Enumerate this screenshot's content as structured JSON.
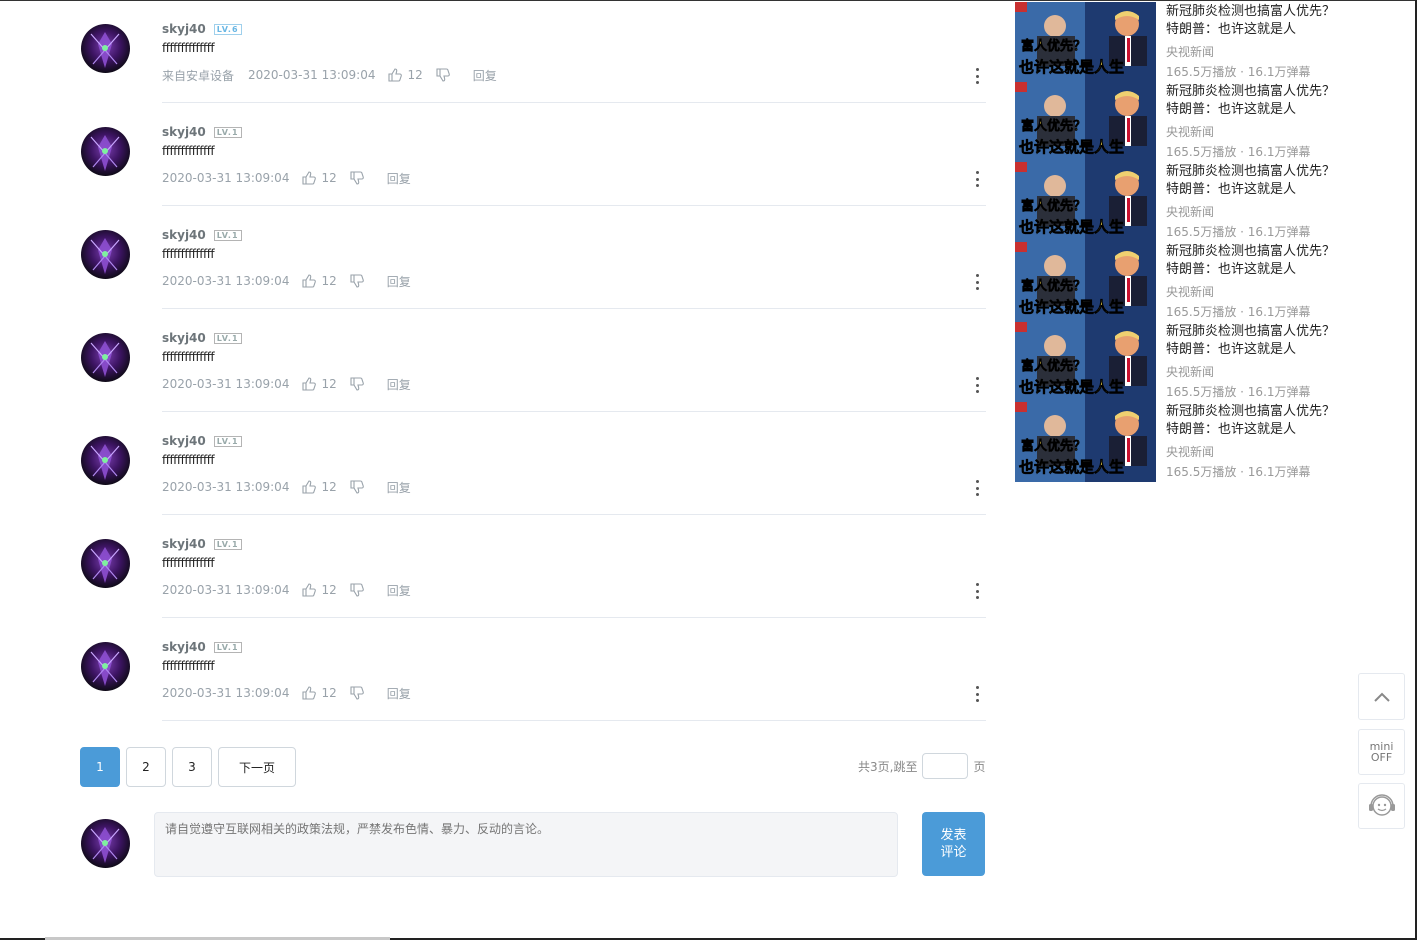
{
  "comments": [
    {
      "user": "skyj40",
      "level": "LV.6",
      "level_color": "blue",
      "text": "ffffffffffffff",
      "device": "来自安卓设备",
      "time": "2020-03-31 13:09:04",
      "likes": "12",
      "reply": "回复"
    },
    {
      "user": "skyj40",
      "level": "LV.1",
      "level_color": "gray",
      "text": "ffffffffffffff",
      "device": "",
      "time": "2020-03-31 13:09:04",
      "likes": "12",
      "reply": "回复"
    },
    {
      "user": "skyj40",
      "level": "LV.1",
      "level_color": "gray",
      "text": "ffffffffffffff",
      "device": "",
      "time": "2020-03-31 13:09:04",
      "likes": "12",
      "reply": "回复"
    },
    {
      "user": "skyj40",
      "level": "LV.1",
      "level_color": "gray",
      "text": "ffffffffffffff",
      "device": "",
      "time": "2020-03-31 13:09:04",
      "likes": "12",
      "reply": "回复"
    },
    {
      "user": "skyj40",
      "level": "LV.1",
      "level_color": "gray",
      "text": "ffffffffffffff",
      "device": "",
      "time": "2020-03-31 13:09:04",
      "likes": "12",
      "reply": "回复"
    },
    {
      "user": "skyj40",
      "level": "LV.1",
      "level_color": "gray",
      "text": "ffffffffffffff",
      "device": "",
      "time": "2020-03-31 13:09:04",
      "likes": "12",
      "reply": "回复"
    },
    {
      "user": "skyj40",
      "level": "LV.1",
      "level_color": "gray",
      "text": "ffffffffffffff",
      "device": "",
      "time": "2020-03-31 13:09:04",
      "likes": "12",
      "reply": "回复"
    }
  ],
  "pagination": {
    "pages": [
      "1",
      "2",
      "3"
    ],
    "current": "1",
    "next_label": "下一页",
    "jump_prefix": "共3页,跳至",
    "jump_suffix": "页"
  },
  "compose": {
    "placeholder": "请自觉遵守互联网相关的政策法规，严禁发布色情、暴力、反动的言论。",
    "submit_line1": "发表",
    "submit_line2": "评论"
  },
  "recommendations": [
    {
      "title": "新冠肺炎检测也搞富人优先？特朗普：也许这就是人",
      "uploader": "央视新闻",
      "stats": "165.5万播放 · 16.1万弹幕",
      "caption1": "富人优先？",
      "caption2": "也许这就是人生"
    },
    {
      "title": "新冠肺炎检测也搞富人优先？特朗普：也许这就是人",
      "uploader": "央视新闻",
      "stats": "165.5万播放 · 16.1万弹幕",
      "caption1": "富人优先？",
      "caption2": "也许这就是人生"
    },
    {
      "title": "新冠肺炎检测也搞富人优先？特朗普：也许这就是人",
      "uploader": "央视新闻",
      "stats": "165.5万播放 · 16.1万弹幕",
      "caption1": "富人优先？",
      "caption2": "也许这就是人生"
    },
    {
      "title": "新冠肺炎检测也搞富人优先？特朗普：也许这就是人",
      "uploader": "央视新闻",
      "stats": "165.5万播放 · 16.1万弹幕",
      "caption1": "富人优先？",
      "caption2": "也许这就是人生"
    },
    {
      "title": "新冠肺炎检测也搞富人优先？特朗普：也许这就是人",
      "uploader": "央视新闻",
      "stats": "165.5万播放 · 16.1万弹幕",
      "caption1": "富人优先？",
      "caption2": "也许这就是人生"
    },
    {
      "title": "新冠肺炎检测也搞富人优先？特朗普：也许这就是人",
      "uploader": "央视新闻",
      "stats": "165.5万播放 · 16.1万弹幕",
      "caption1": "富人优先？",
      "caption2": "也许这就是人生"
    }
  ],
  "side_tools": {
    "mini_line1": "mini",
    "mini_line2": "OFF",
    "icons": [
      "chevron-up-icon",
      "customer-service-icon"
    ]
  },
  "colors": {
    "accent": "#4b9bd8",
    "level_blue": "#6ab7e4",
    "muted_text": "#99a2aa",
    "divider": "#e5e9ef"
  }
}
